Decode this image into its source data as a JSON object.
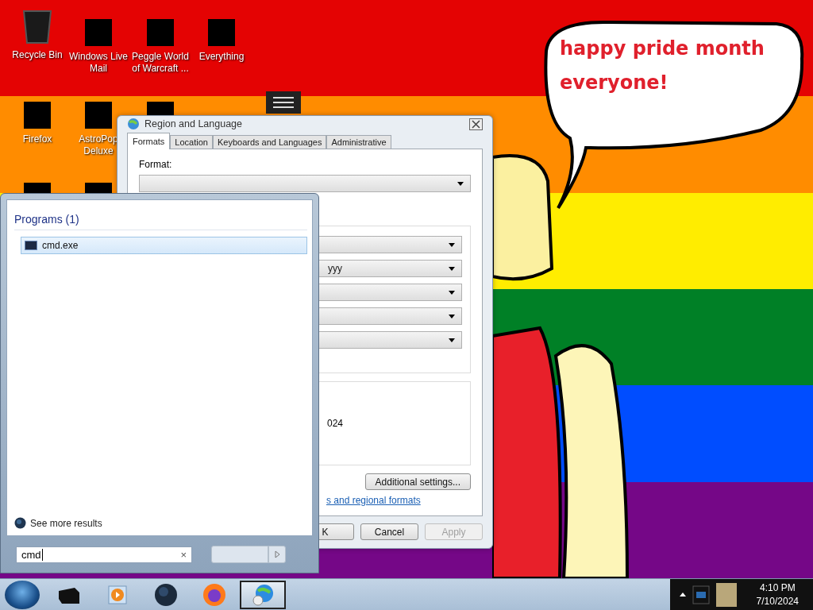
{
  "desktop": {
    "speech_bubble": "happy pride month everyone!",
    "icons": [
      {
        "kind": "bin",
        "label": "Recycle Bin"
      },
      {
        "kind": "censored",
        "label": "Windows Live Mail"
      },
      {
        "kind": "censored",
        "label": "Peggle World of Warcraft ..."
      },
      {
        "kind": "censored",
        "label": "Everything"
      },
      {
        "kind": "censored",
        "label": "Firefox"
      },
      {
        "kind": "censored",
        "label": "AstroPop Deluxe"
      },
      {
        "kind": "censored"
      },
      {
        "kind": "list"
      },
      {
        "kind": "censored"
      },
      {
        "kind": "censored"
      }
    ]
  },
  "dialog": {
    "title": "Region and Language",
    "tabs": [
      {
        "label": "Formats",
        "selected": true
      },
      {
        "label": "Location",
        "selected": false
      },
      {
        "label": "Keyboards and Languages",
        "selected": false
      },
      {
        "label": "Administrative",
        "selected": false
      }
    ],
    "format_label": "Format:",
    "date_time_dropdowns": [
      {
        "kind": "dropdown"
      },
      {
        "kind": "dropdown",
        "value": "yyy"
      },
      {
        "kind": "dropdown"
      },
      {
        "kind": "dropdown"
      },
      {
        "kind": "dropdown"
      }
    ],
    "example_text": "024",
    "additional_button": "Additional settings...",
    "link": "s and regional formats",
    "buttons": [
      {
        "label": "K",
        "disabled": false
      },
      {
        "label": "Cancel",
        "disabled": false
      },
      {
        "label": "Apply",
        "disabled": true
      }
    ]
  },
  "start_menu": {
    "header": "Programs (1)",
    "results": [
      {
        "label": "cmd.exe",
        "selected": true
      }
    ],
    "see_more": "See more results",
    "search": {
      "value": "cmd",
      "clear": "×"
    }
  },
  "taskbar": {
    "apps": [
      {
        "kind": "device",
        "selected": false
      },
      {
        "kind": "media",
        "selected": false
      },
      {
        "kind": "globe",
        "selected": false
      },
      {
        "kind": "firefox",
        "selected": false
      },
      {
        "kind": "region",
        "selected": true
      }
    ],
    "time": "4:10 PM",
    "date": "7/10/2024"
  }
}
